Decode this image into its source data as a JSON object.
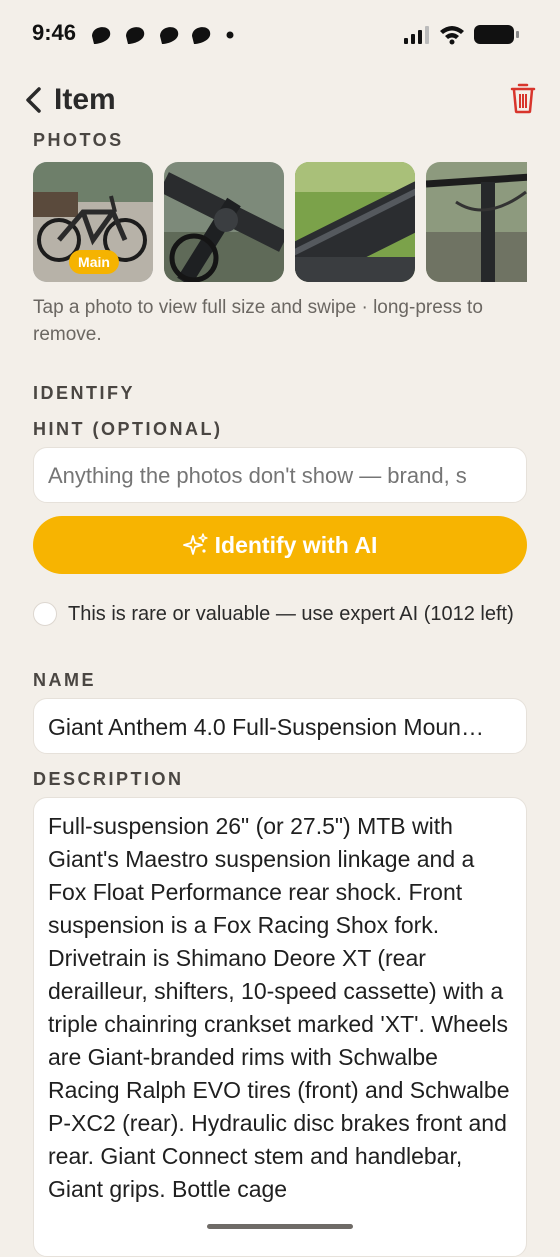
{
  "status": {
    "time": "9:46"
  },
  "nav": {
    "title": "Item",
    "back_icon": "chevron-left-icon",
    "delete_icon": "trash-icon",
    "delete_color": "#d8352c"
  },
  "photos": {
    "label": "PHOTOS",
    "main_badge": "Main",
    "help": "Tap a photo to view full size and swipe · long-press to remove."
  },
  "identify": {
    "label": "IDENTIFY",
    "hint_label": "HINT (OPTIONAL)",
    "hint_placeholder": "Anything the photos don't show — brand, s",
    "button_label": "Identify with AI",
    "button_icon": "sparkles-icon",
    "button_color": "#f7b401",
    "expert_option": "This is rare or valuable — use expert AI (1012 left)"
  },
  "name": {
    "label": "NAME",
    "value": "Giant Anthem 4.0 Full-Suspension Moun…"
  },
  "description": {
    "label": "DESCRIPTION",
    "value": "Full-suspension 26\" (or 27.5\") MTB with Giant's Maestro suspension linkage and a Fox Float Performance rear shock. Front suspension is a Fox Racing Shox fork. Drivetrain is Shimano Deore XT (rear derailleur, shifters, 10-speed cassette) with a triple chainring crankset marked 'XT'. Wheels are Giant-branded rims with Schwalbe Racing Ralph EVO tires (front) and Schwalbe P-XC2 (rear). Hydraulic disc brakes front and rear. Giant Connect stem and handlebar, Giant grips. Bottle cage"
  }
}
